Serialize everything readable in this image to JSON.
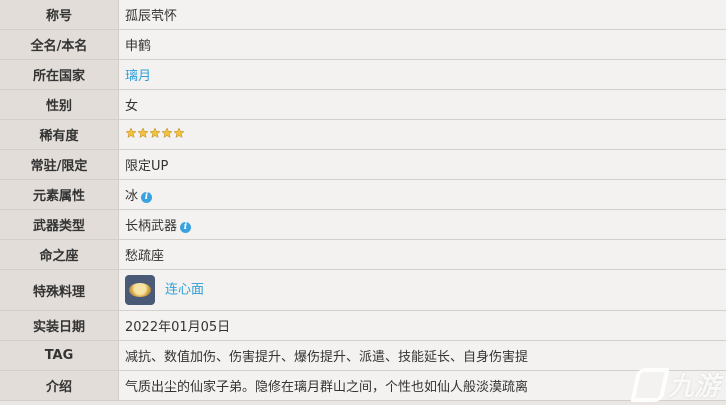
{
  "rows": {
    "title": {
      "label": "称号",
      "value": "孤辰茕怀"
    },
    "name": {
      "label": "全名/本名",
      "value": "申鹤"
    },
    "nation": {
      "label": "所在国家",
      "value": "璃月"
    },
    "gender": {
      "label": "性别",
      "value": "女"
    },
    "rarity": {
      "label": "稀有度",
      "stars": 5
    },
    "banner": {
      "label": "常驻/限定",
      "value": "限定UP"
    },
    "element": {
      "label": "元素属性",
      "value": "冰"
    },
    "weapon": {
      "label": "武器类型",
      "value": "长柄武器"
    },
    "constellation": {
      "label": "命之座",
      "value": "愁疏座"
    },
    "dish": {
      "label": "特殊料理",
      "value": "连心面"
    },
    "release": {
      "label": "实装日期",
      "value": "2022年01月05日"
    },
    "tag": {
      "label": "TAG",
      "value": "减抗、数值加伤、伤害提升、爆伤提升、派遣、技能延长、自身伤害提"
    },
    "intro": {
      "label": "介绍",
      "value": "气质出尘的仙家子弟。隐修在璃月群山之间，个性也如仙人般淡漠疏离"
    }
  },
  "watermark": "九游",
  "colors": {
    "link": "#2fa0d8",
    "label_bg": "#e2ddd8",
    "value_bg": "#f4f2f0",
    "star": "#f2c23a"
  }
}
